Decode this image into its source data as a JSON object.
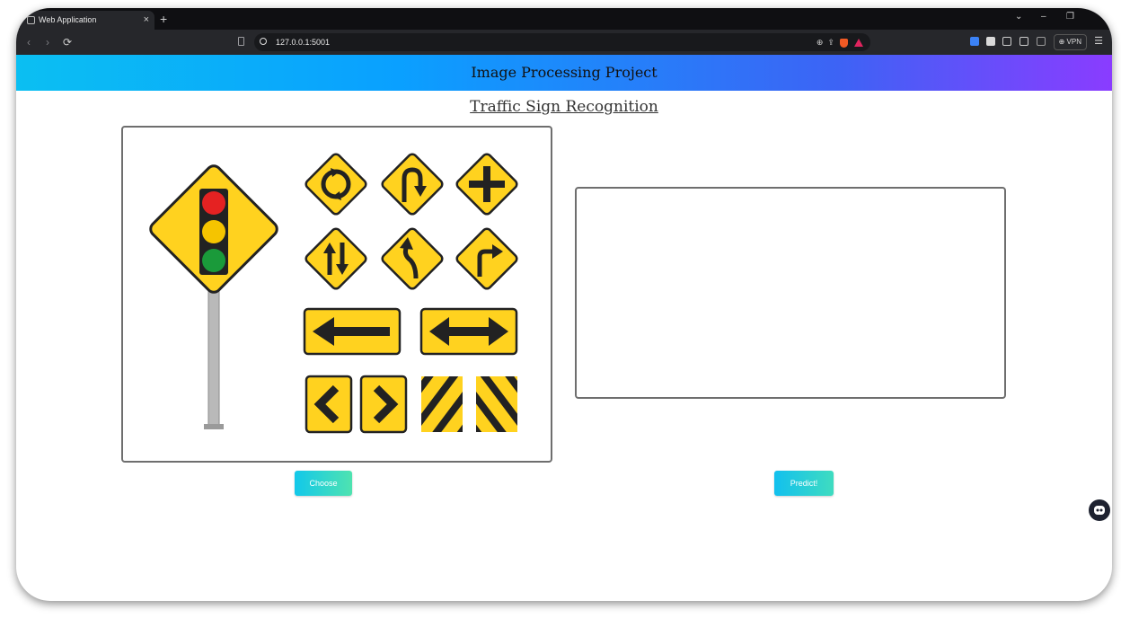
{
  "browser": {
    "tab_title": "Web Application",
    "tab_close": "×",
    "new_tab": "+",
    "url": "127.0.0.1:5001",
    "vpn_label": "VPN",
    "window_controls": [
      "⌄",
      "–",
      "❐"
    ]
  },
  "header": {
    "title": "Image Processing Project"
  },
  "page": {
    "title": "Traffic Sign Recognition"
  },
  "buttons": {
    "choose": "Choose",
    "predict": "Predict!"
  },
  "image": {
    "description_icon": "traffic-signs-image"
  },
  "result": {
    "text": ""
  },
  "colors": {
    "header_gradient": [
      "#0bbff2",
      "#3d63f5",
      "#8a3cff"
    ],
    "button_gradient": [
      "#12c8ea",
      "#4fe3b0"
    ],
    "sign_yellow": "#ffd21f"
  }
}
